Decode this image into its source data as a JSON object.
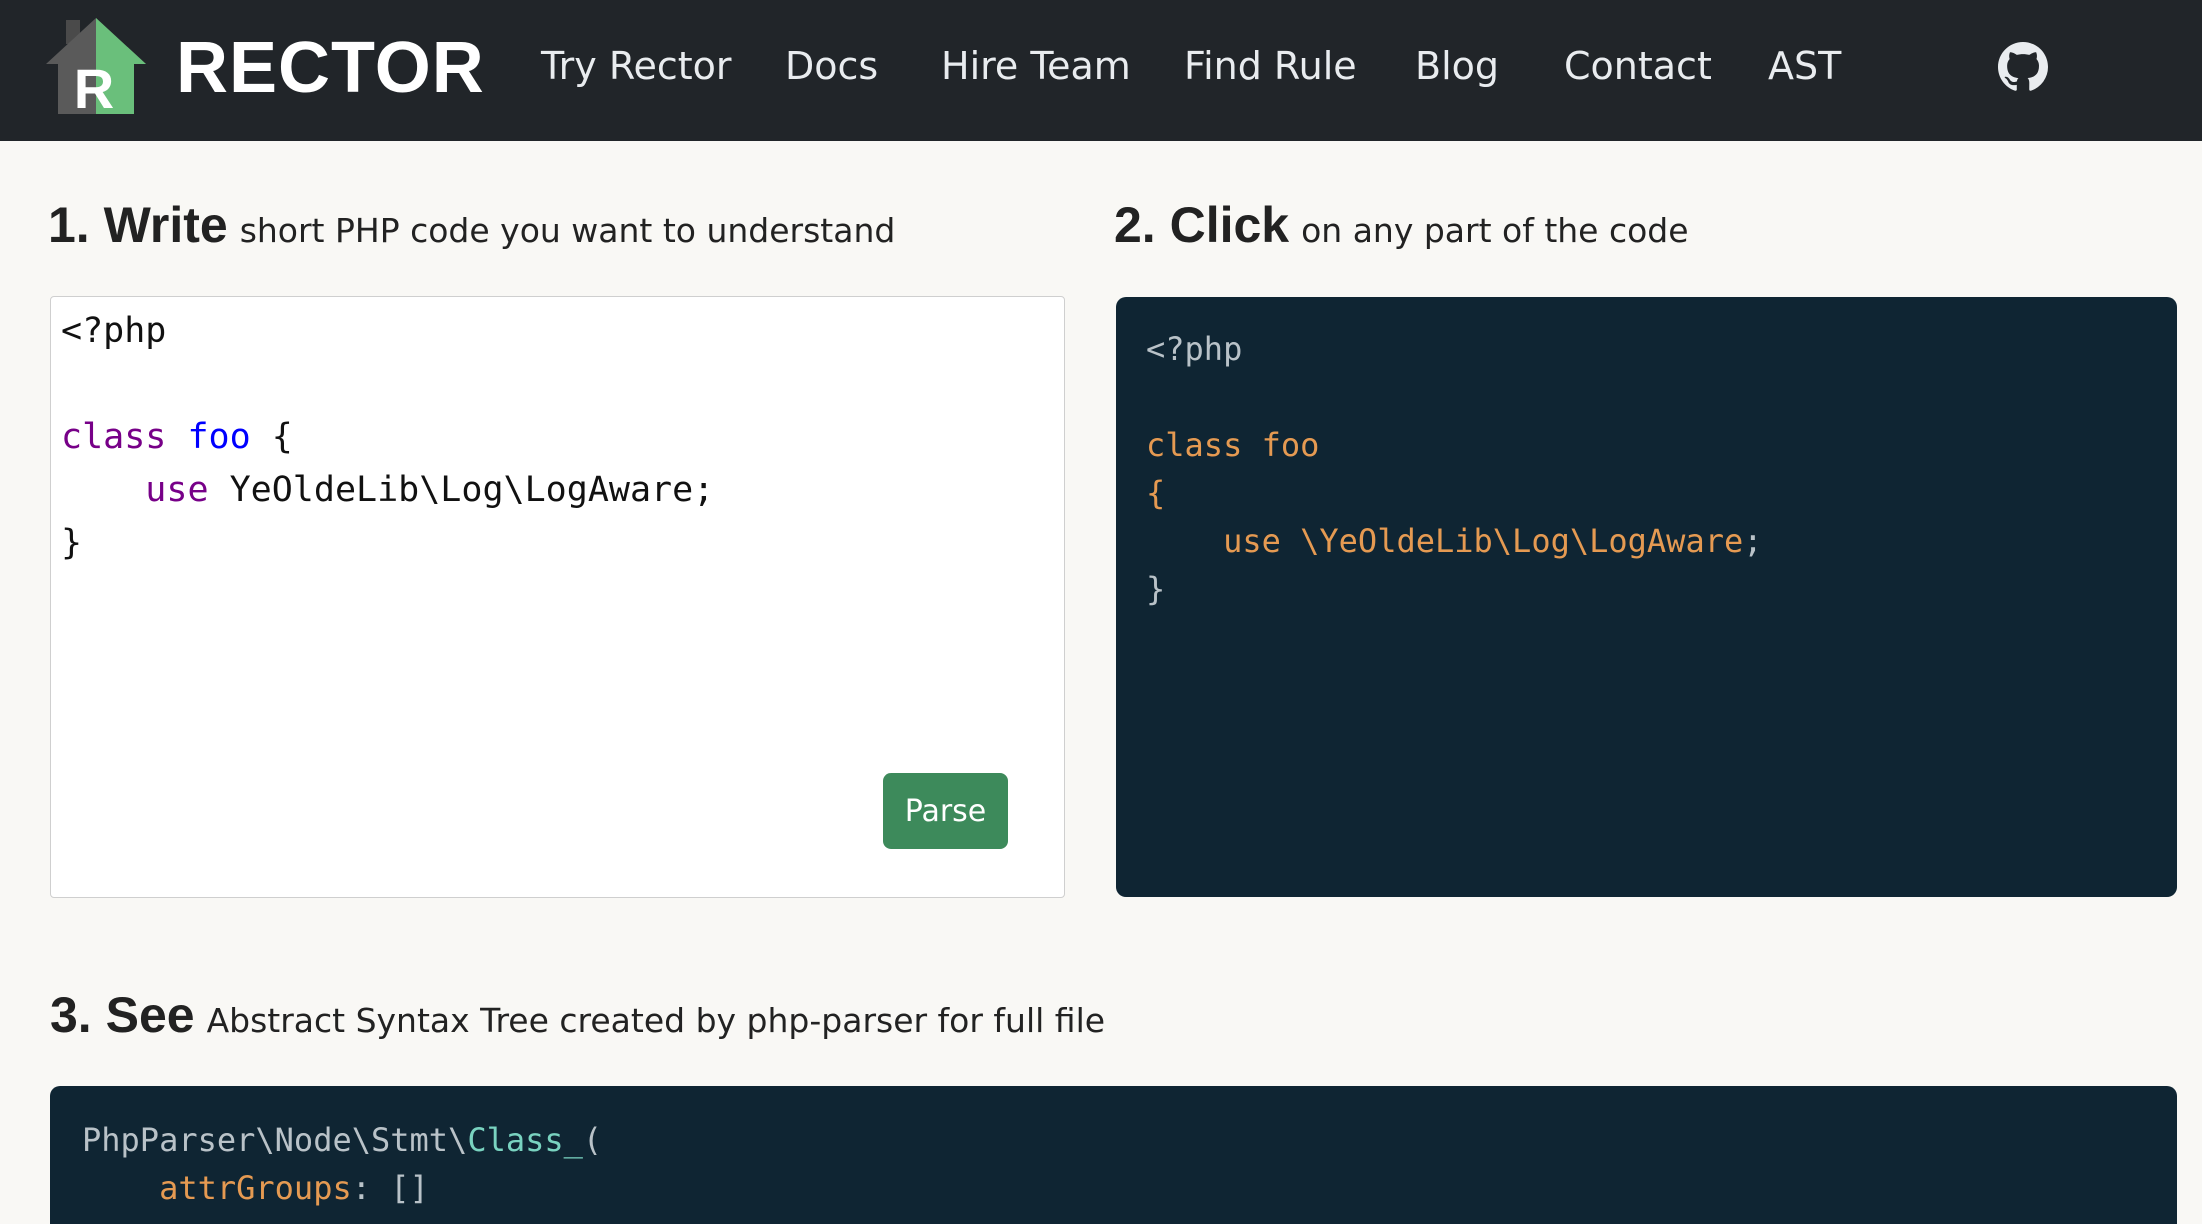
{
  "brand": {
    "name": "RECTOR",
    "logo_letter": "R"
  },
  "nav": {
    "items": [
      "Try Rector",
      "Docs",
      "Hire Team",
      "Find Rule",
      "Blog",
      "Contact",
      "AST"
    ],
    "github_icon": "github-icon"
  },
  "step1": {
    "title": "1. Write",
    "subtitle": "short PHP code you want to understand"
  },
  "step2": {
    "title": "2. Click",
    "subtitle": "on any part of the code"
  },
  "step3": {
    "title": "3. See",
    "subtitle": "Abstract Syntax Tree created by php-parser for full file"
  },
  "editor": {
    "line1": "<?php",
    "kw_class": "class",
    "class_name": "foo",
    "brace_open": "{",
    "kw_use": "use",
    "use_target": "YeOldeLib\\Log\\LogAware;",
    "brace_close": "}"
  },
  "parse_button": "Parse",
  "clickable_code": {
    "open_tag": "<?php",
    "class_decl": "class foo",
    "brace_open": "{",
    "use_stmt": "use \\YeOldeLib\\Log\\LogAware",
    "semicolon": ";",
    "brace_close": "}"
  },
  "ast": {
    "namespace": "PhpParser\\Node\\Stmt\\",
    "class_name": "Class_",
    "paren": "(",
    "attr_key": "attrGroups",
    "attr_sep": ": ",
    "attr_value": "[]"
  },
  "colors": {
    "navbar": "#212529",
    "logo_grey": "#5a5a5a",
    "logo_green": "#6abf7b",
    "parse_button": "#3d8a5b",
    "dark_panel": "#0f2533",
    "code_orange": "#e59a52",
    "code_teal": "#79d3c0"
  }
}
